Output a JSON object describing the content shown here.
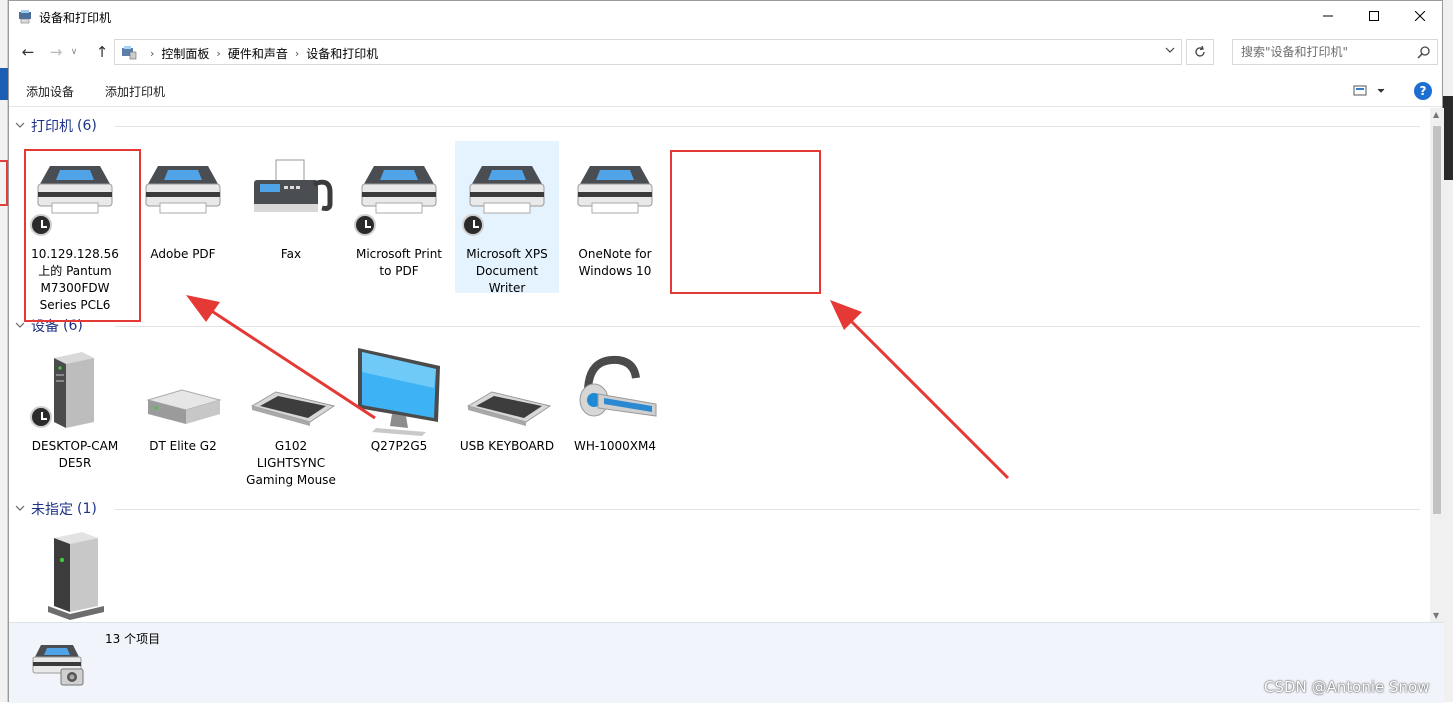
{
  "window": {
    "title": "设备和打印机",
    "minimize": "—",
    "maximize": "☐",
    "close": "✕"
  },
  "nav": {
    "back": "←",
    "forward": "→",
    "recent": "∨",
    "up": "↑"
  },
  "address": {
    "crumbs": [
      "控制面板",
      "硬件和声音",
      "设备和打印机"
    ],
    "separator": "›"
  },
  "search": {
    "placeholder": "搜索\"设备和打印机\""
  },
  "toolbar": {
    "add_device": "添加设备",
    "add_printer": "添加打印机",
    "help": "?"
  },
  "groups": {
    "printers": {
      "label": "打印机",
      "count": "(6)",
      "items": [
        {
          "name": "10.129.128.56 上的 Pantum M7300FDW Series PCL6",
          "icon": "printer-icon",
          "badge": "default-clock"
        },
        {
          "name": "Adobe PDF",
          "icon": "printer-icon"
        },
        {
          "name": "Fax",
          "icon": "fax-icon"
        },
        {
          "name": "Microsoft Print to PDF",
          "icon": "printer-icon",
          "badge": "default-clock"
        },
        {
          "name": "Microsoft XPS Document Writer",
          "icon": "printer-icon",
          "badge": "default-clock",
          "selected": true
        },
        {
          "name": "OneNote for Windows 10",
          "icon": "printer-icon"
        }
      ]
    },
    "devices": {
      "label": "设备",
      "count": "(6)",
      "items": [
        {
          "name": "DESKTOP-CAM DE5R",
          "icon": "computer-tower-icon",
          "badge": "default-clock"
        },
        {
          "name": "DT Elite G2",
          "icon": "usb-drive-icon"
        },
        {
          "name": "G102 LIGHTSYNC Gaming Mouse",
          "icon": "keyboard-icon"
        },
        {
          "name": "Q27P2G5",
          "icon": "monitor-icon"
        },
        {
          "name": "USB KEYBOARD",
          "icon": "keyboard-icon"
        },
        {
          "name": "WH-1000XM4",
          "icon": "headset-icon"
        }
      ]
    },
    "unspecified": {
      "label": "未指定",
      "count": "(1)",
      "items": [
        {
          "name": "",
          "icon": "server-icon"
        }
      ]
    }
  },
  "status": {
    "item_count": "13 个项目"
  },
  "watermark": "CSDN @Antonie Snow",
  "colors": {
    "group_header": "#1e3287",
    "annotation_red": "#e53935",
    "selection": "#e5f3ff",
    "details_pane": "#f1f5fb"
  }
}
